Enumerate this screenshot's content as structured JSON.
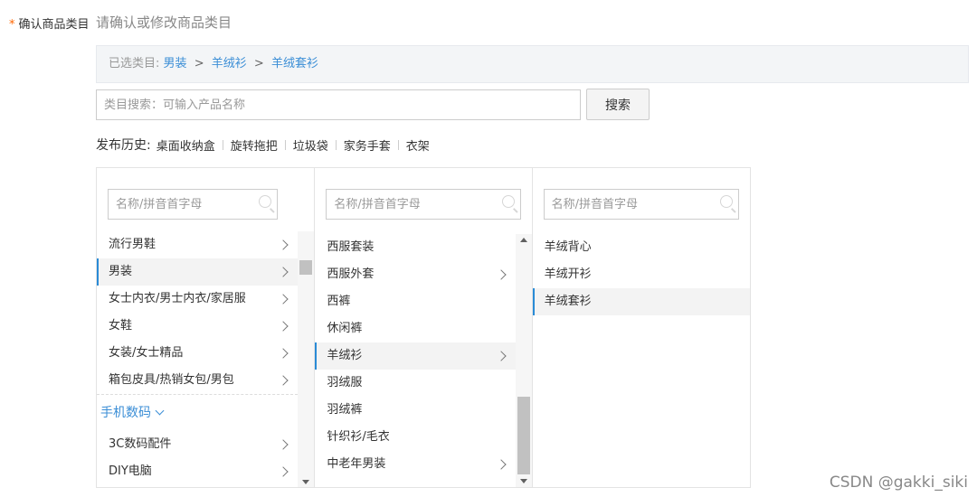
{
  "field": {
    "required_mark": "*",
    "label": "确认商品类目",
    "hint": "请确认或修改商品类目"
  },
  "selected": {
    "prefix": "已选类目:",
    "path": [
      "男装",
      "羊绒衫",
      "羊绒套衫"
    ],
    "separator": ">"
  },
  "search": {
    "placeholder": "类目搜索：可输入产品名称",
    "button_label": "搜索"
  },
  "history": {
    "label": "发布历史:",
    "items": [
      "桌面收纳盒",
      "旋转拖把",
      "垃圾袋",
      "家务手套",
      "衣架"
    ]
  },
  "columns": {
    "search_placeholder": "名称/拼音首字母",
    "col1": {
      "items": [
        {
          "label": "流行男鞋",
          "has_children": true,
          "active": false
        },
        {
          "label": "男装",
          "has_children": true,
          "active": true
        },
        {
          "label": "女士内衣/男士内衣/家居服",
          "has_children": true,
          "active": false
        },
        {
          "label": "女鞋",
          "has_children": true,
          "active": false
        },
        {
          "label": "女装/女士精品",
          "has_children": true,
          "active": false
        },
        {
          "label": "箱包皮具/热销女包/男包",
          "has_children": true,
          "active": false
        }
      ],
      "group": "手机数码",
      "group_items": [
        {
          "label": "3C数码配件",
          "has_children": true
        },
        {
          "label": "DIY电脑",
          "has_children": true
        }
      ]
    },
    "col2": {
      "items": [
        {
          "label": "西服套装",
          "has_children": false,
          "active": false
        },
        {
          "label": "西服外套",
          "has_children": true,
          "active": false
        },
        {
          "label": "西裤",
          "has_children": false,
          "active": false
        },
        {
          "label": "休闲裤",
          "has_children": false,
          "active": false
        },
        {
          "label": "羊绒衫",
          "has_children": true,
          "active": true
        },
        {
          "label": "羽绒服",
          "has_children": false,
          "active": false
        },
        {
          "label": "羽绒裤",
          "has_children": false,
          "active": false
        },
        {
          "label": "针织衫/毛衣",
          "has_children": false,
          "active": false
        },
        {
          "label": "中老年男装",
          "has_children": true,
          "active": false
        }
      ]
    },
    "col3": {
      "items": [
        {
          "label": "羊绒背心",
          "active": false
        },
        {
          "label": "羊绒开衫",
          "active": false
        },
        {
          "label": "羊绒套衫",
          "active": true
        }
      ]
    }
  },
  "colors": {
    "accent": "#2a8bd6",
    "link": "#3b8ed6",
    "required": "#ff6600"
  },
  "watermark": "CSDN @gakki_siki"
}
